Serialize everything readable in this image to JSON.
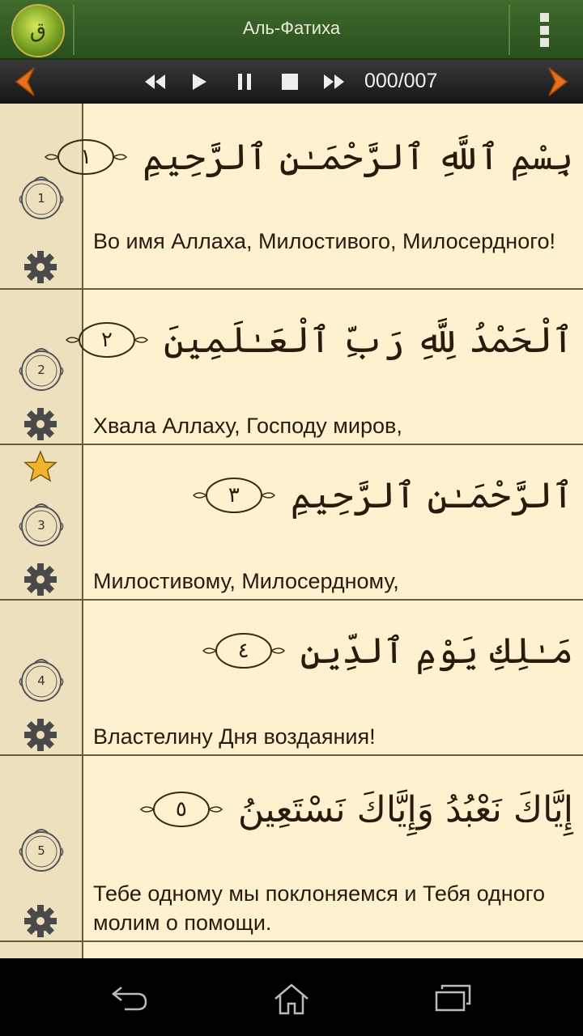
{
  "appbar": {
    "title": "Аль-Фатиха",
    "logo_icon": "quran-logo-icon",
    "menu_icon": "overflow-menu-icon"
  },
  "player": {
    "counter": "000/007",
    "controls": [
      "prev-surah-icon",
      "rewind-icon",
      "play-icon",
      "pause-icon",
      "stop-icon",
      "fast-forward-icon",
      "next-surah-icon"
    ],
    "accent": "#e8701a"
  },
  "verses": [
    {
      "number": "1",
      "arabic": "بِسْمِ ٱللَّهِ ٱلرَّحْمَـٰنِ ٱلرَّحِيمِ",
      "ayah_marker": "١",
      "translation": "Во имя Аллаха, Милостивого, Милосердного!",
      "bookmarked": false
    },
    {
      "number": "2",
      "arabic": "ٱلْحَمْدُ لِلَّهِ رَبِّ ٱلْعَـٰلَمِينَ",
      "ayah_marker": "٢",
      "translation": "Хвала Аллаху, Господу миров,",
      "bookmarked": false
    },
    {
      "number": "3",
      "arabic": "ٱلرَّحْمَـٰنِ ٱلرَّحِيمِ",
      "ayah_marker": "٣",
      "translation": "Милостивому, Милосердному,",
      "bookmarked": true
    },
    {
      "number": "4",
      "arabic": "مَـٰلِكِ يَوْمِ ٱلدِّينِ",
      "ayah_marker": "٤",
      "translation": "Властелину Дня воздаяния!",
      "bookmarked": false
    },
    {
      "number": "5",
      "arabic": "إِيَّاكَ نَعْبُدُ وَإِيَّاكَ نَسْتَعِينُ",
      "ayah_marker": "٥",
      "translation": "Тебе одному мы поклоняемся и Тебя одного молим о помощи.",
      "bookmarked": false
    }
  ],
  "colors": {
    "background": "#fdf1cf",
    "gutter": "#ede0bd",
    "text": "#2b1a0c",
    "appbar": "#3f6b2c"
  }
}
